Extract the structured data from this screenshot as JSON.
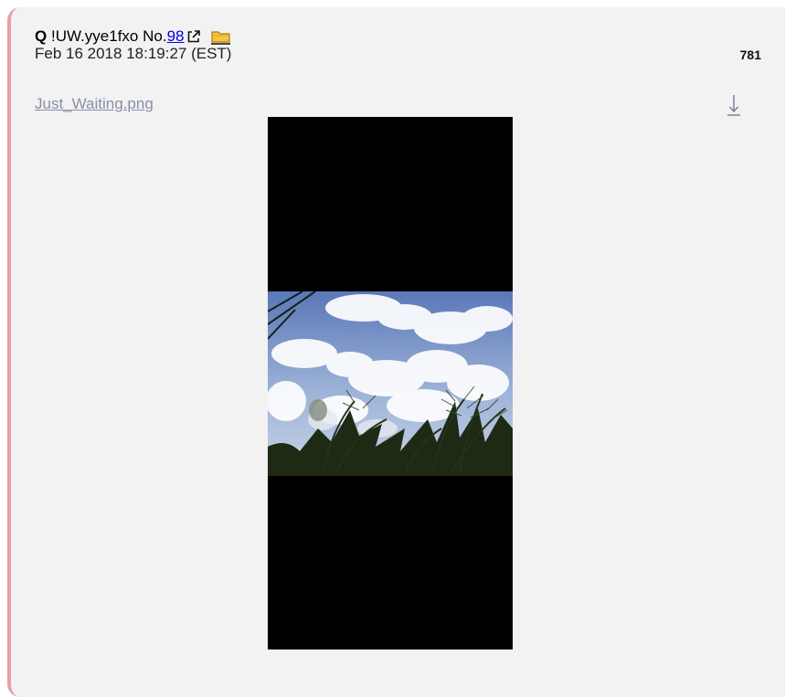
{
  "post": {
    "author": "Q",
    "tripcode": "!UW.yye1fxo",
    "number_prefix": "No.",
    "number": "98",
    "date": "Feb 16 2018 18:19:27 (EST)",
    "reply_count": "781",
    "file": {
      "name": "Just_Waiting.png"
    }
  },
  "colors": {
    "post_background": "#f2f2f2",
    "accent_border": "#eaa0a0",
    "link": "#0000ee",
    "filename": "#8a8fa8"
  },
  "icons": {
    "external_link": "external-link-icon",
    "folder": "folder-icon",
    "download": "download-icon"
  }
}
